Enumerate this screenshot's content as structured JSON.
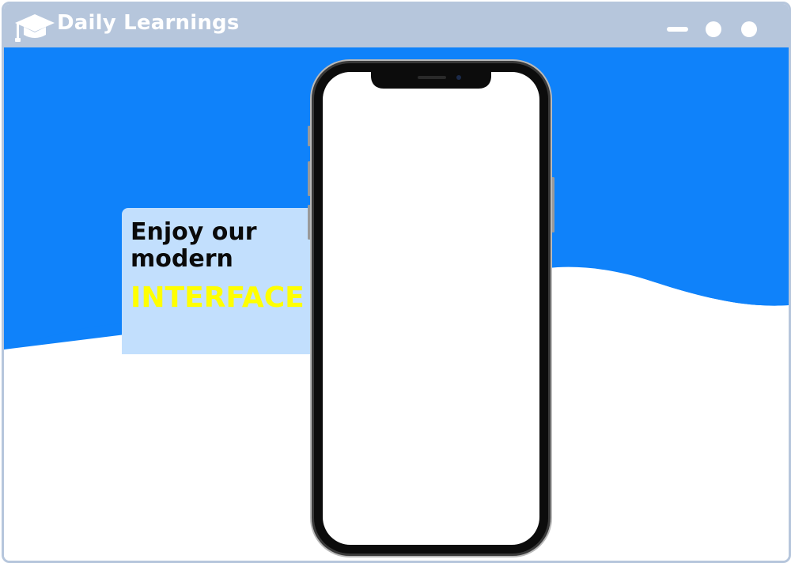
{
  "titlebar": {
    "app_title": "Daily Learnings",
    "logo_icon": "graduation-cap-icon",
    "controls": {
      "minimize_icon": "minimize-icon",
      "maximize_icon": "maximize-icon",
      "close_icon": "close-icon"
    }
  },
  "hero": {
    "promo": {
      "line1": "Enjoy our",
      "line2": "modern",
      "accent": "INTERFACE"
    },
    "phone_icon": "smartphone-mockup"
  },
  "colors": {
    "titlebar": "#b6c6dc",
    "hero_blue": "#0f82fa",
    "promo_card": "#c2dffd",
    "accent_yellow": "#ffff00",
    "text_dark": "#0a0a0a"
  }
}
